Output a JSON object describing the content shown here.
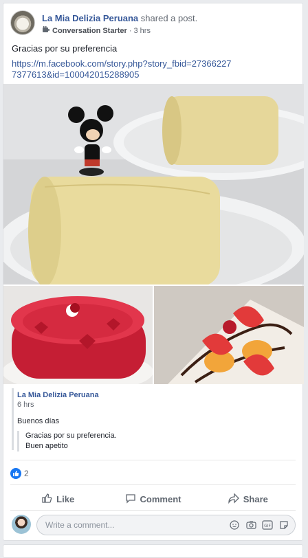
{
  "post": {
    "page_name": "La Mia Delizia Peruana",
    "shared_text": "shared a post.",
    "badge": "Conversation Starter",
    "separator": "·",
    "time": "3 hrs",
    "text": "Gracias por su preferencia",
    "link": "https://m.facebook.com/story.php?story_fbid=273662277377613&id=100042015288905"
  },
  "quote": {
    "author": "La Mia Delizia Peruana",
    "time": "6 hrs",
    "greeting": "Buenos días",
    "inner_line1": "Gracias por su preferencia.",
    "inner_line2": "Buen apetito"
  },
  "reactions": {
    "count": "2"
  },
  "actions": {
    "like": "Like",
    "comment": "Comment",
    "share": "Share"
  },
  "comment": {
    "placeholder": "Write a comment..."
  },
  "colors": {
    "link": "#365899",
    "like_blue": "#1877f2",
    "action_gray": "#606770"
  },
  "icons": [
    "badge-icon",
    "like-icon",
    "comment-icon",
    "share-icon",
    "emoji-icon",
    "camera-icon",
    "gif-icon",
    "sticker-icon"
  ]
}
